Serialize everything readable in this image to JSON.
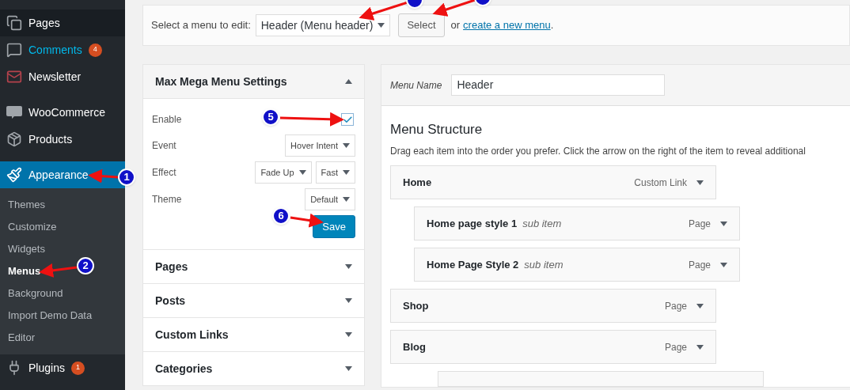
{
  "sidebar": {
    "items": [
      {
        "label": "Pages",
        "kind": "pages",
        "active": false,
        "hovered": false
      },
      {
        "label": "Comments",
        "kind": "comments",
        "badge": "4",
        "active": false,
        "hovered": true
      },
      {
        "label": "Newsletter",
        "kind": "mail",
        "active": false,
        "hovered": false
      },
      {
        "label": "WooCommerce",
        "kind": "woo",
        "active": false,
        "hovered": false
      },
      {
        "label": "Products",
        "kind": "box",
        "active": false,
        "hovered": false
      },
      {
        "label": "Appearance",
        "kind": "brush",
        "active": true,
        "hovered": false,
        "children": [
          {
            "label": "Themes",
            "selected": false
          },
          {
            "label": "Customize",
            "selected": false
          },
          {
            "label": "Widgets",
            "selected": false
          },
          {
            "label": "Menus",
            "selected": true
          },
          {
            "label": "Background",
            "selected": false
          },
          {
            "label": "Import Demo Data",
            "selected": false
          },
          {
            "label": "Editor",
            "selected": false
          }
        ]
      },
      {
        "label": "Plugins",
        "kind": "plug",
        "badge": "1",
        "active": false,
        "hovered": false
      }
    ]
  },
  "menu_select": {
    "label": "Select a menu to edit:",
    "value": "Header (Menu header)",
    "button": "Select",
    "or": "or",
    "link": "create a new menu",
    "end": "."
  },
  "settings_panel": {
    "title": "Max Mega Menu Settings",
    "expanded": true,
    "rows": [
      {
        "kind": "checkbox",
        "label": "Enable",
        "checked": true
      },
      {
        "kind": "select",
        "label": "Event",
        "options": [
          "Hover Intent"
        ]
      },
      {
        "kind": "select",
        "label": "Effect",
        "options": [
          "Fade Up",
          "Fast"
        ]
      },
      {
        "kind": "select",
        "label": "Theme",
        "options": [
          "Default"
        ]
      }
    ],
    "save": "Save"
  },
  "accordions": [
    {
      "title": "Pages",
      "expanded": false
    },
    {
      "title": "Posts",
      "expanded": false
    },
    {
      "title": "Custom Links",
      "expanded": false
    },
    {
      "title": "Categories",
      "expanded": false
    }
  ],
  "menu_name": {
    "label": "Menu Name",
    "value": "Header"
  },
  "menu_structure": {
    "title": "Menu Structure",
    "description": "Drag each item into the order you prefer. Click the arrow on the right of the item to reveal additional",
    "items": [
      {
        "title": "Home",
        "type": "Custom Link",
        "children": [
          {
            "title": "Home page style 1",
            "note": "sub item",
            "type": "Page"
          },
          {
            "title": "Home Page Style 2",
            "note": "sub item",
            "type": "Page"
          }
        ]
      },
      {
        "title": "Shop",
        "type": "Page"
      },
      {
        "title": "Blog",
        "type": "Page",
        "children": [
          {
            "kind": "cut"
          }
        ]
      }
    ]
  },
  "annotations": [
    {
      "kind": "full",
      "number": "1"
    },
    {
      "kind": "full",
      "number": "2"
    },
    {
      "kind": "cut"
    },
    {
      "kind": "cut"
    },
    {
      "kind": "full",
      "number": "5"
    },
    {
      "kind": "full",
      "number": "6"
    }
  ]
}
